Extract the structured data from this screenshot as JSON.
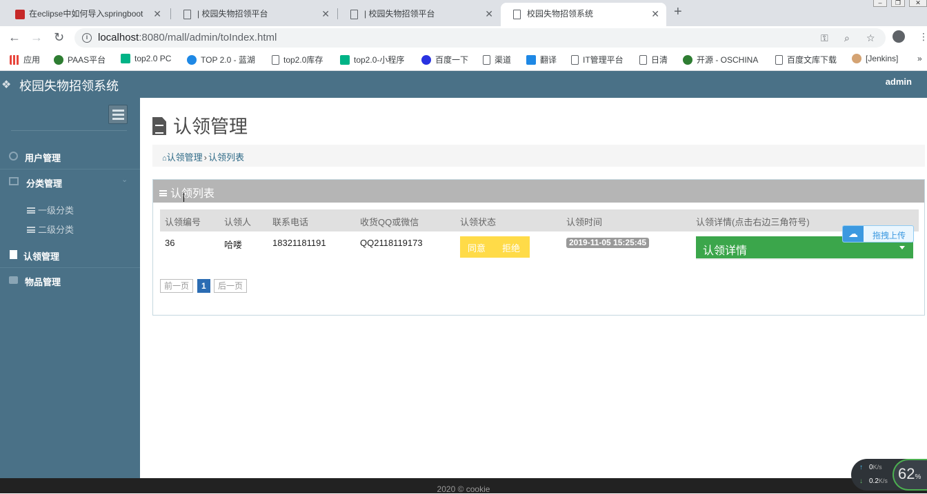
{
  "browser": {
    "tabs": [
      {
        "title": "在eclipse中如何导入springboot",
        "active": false
      },
      {
        "title": "| 校园失物招领平台",
        "active": false
      },
      {
        "title": "| 校园失物招领平台",
        "active": false
      },
      {
        "title": "校园失物招领系统",
        "active": true
      }
    ],
    "close_glyph": "✕",
    "new_tab_glyph": "+",
    "url_host": "localhost",
    "url_rest": ":8080/mall/admin/toIndex.html",
    "bookmarks": [
      {
        "label": "应用",
        "icon": "apps-grid-icon",
        "color": "#e8453c"
      },
      {
        "label": "PAAS平台",
        "icon": "paas-icon",
        "color": "#2e7d32"
      },
      {
        "label": "top2.0 PC",
        "icon": "play-icon",
        "color": "#00b386"
      },
      {
        "label": "TOP 2.0 - 蓝湖",
        "icon": "lanhu-icon",
        "color": "#1e88e5"
      },
      {
        "label": "top2.0库存",
        "icon": "page-icon",
        "color": "#ffffff"
      },
      {
        "label": "top2.0-小程序",
        "icon": "play-icon",
        "color": "#00b386"
      },
      {
        "label": "百度一下",
        "icon": "baidu-paw-icon",
        "color": "#2932e1"
      },
      {
        "label": "渠道",
        "icon": "page-icon",
        "color": "#ffffff"
      },
      {
        "label": "翻译",
        "icon": "translate-icon",
        "color": "#1e88e5"
      },
      {
        "label": "IT管理平台",
        "icon": "page-icon",
        "color": "#ffffff"
      },
      {
        "label": "日清",
        "icon": "page-icon",
        "color": "#ffffff"
      },
      {
        "label": "开源 - OSCHINA",
        "icon": "oschina-icon",
        "color": "#2e7d32"
      },
      {
        "label": "百度文库下载",
        "icon": "page-icon",
        "color": "#ffffff"
      },
      {
        "label": "[Jenkins]",
        "icon": "jenkins-icon",
        "color": "#d4a373"
      }
    ],
    "more_glyph": "»"
  },
  "app": {
    "brand": "校园失物招领系统",
    "user": "admin",
    "sidebar": [
      {
        "label": "用户管理",
        "icon": "user-circle-icon"
      },
      {
        "label": "分类管理",
        "icon": "category-icon",
        "children": [
          "一级分类",
          "二级分类"
        ]
      },
      {
        "label": "认领管理",
        "icon": "document-icon"
      },
      {
        "label": "物品管理",
        "icon": "briefcase-icon"
      }
    ],
    "page_title": "认领管理",
    "breadcrumb": [
      "认领管理",
      "认领列表"
    ],
    "breadcrumb_sep": "›",
    "panel_title": "认领列表",
    "table": {
      "headers": [
        "认领编号",
        "认领人",
        "联系电话",
        "收货QQ或微信",
        "认领状态",
        "认领时间",
        "认领详情(点击右边三角符号)"
      ],
      "rows": [
        {
          "id": "36",
          "name": "哈喽",
          "phone": "18321181191",
          "contact": "QQ2118119173",
          "approve": "同意",
          "reject": "拒绝",
          "time": "2019-11-05 15:25:45",
          "detail": "认领详情"
        }
      ]
    },
    "pagination": {
      "prev": "前一页",
      "current": "1",
      "next": "后一页"
    },
    "upload_widget": "拖拽上传",
    "footer": "2020 © cookie"
  },
  "netmon": {
    "up": "0",
    "down": "0.2",
    "unit": "K/s",
    "percent": "62",
    "percent_sign": "%"
  },
  "colors": {
    "header": "#4a7187",
    "sidebar": "#4a7187",
    "status_yellow": "#ffdb48",
    "detail_green": "#3ba64b",
    "pager_blue": "#2b6cb3"
  }
}
